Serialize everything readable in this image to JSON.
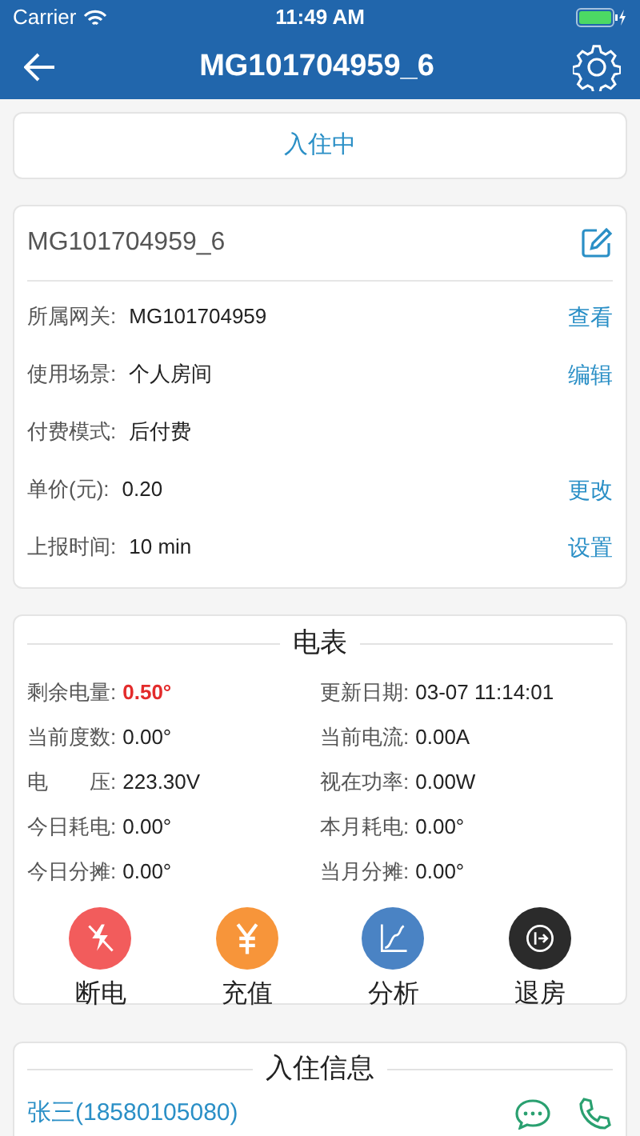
{
  "status_bar": {
    "carrier": "Carrier",
    "time": "11:49 AM"
  },
  "nav": {
    "title": "MG101704959_6"
  },
  "status_button": {
    "label": "入住中"
  },
  "device": {
    "name": "MG101704959_6",
    "rows": [
      {
        "label": "所属网关:",
        "value": "MG101704959",
        "action": "查看"
      },
      {
        "label": "使用场景:",
        "value": "个人房间",
        "action": "编辑"
      },
      {
        "label": "付费模式:",
        "value": "后付费"
      },
      {
        "label": "单价(元):",
        "value": "0.20",
        "action": "更改"
      },
      {
        "label": "上报时间:",
        "value": "10 min",
        "action": "设置"
      }
    ]
  },
  "meter": {
    "title": "电表",
    "readings": [
      {
        "label": "剩余电量:",
        "value": "0.50°",
        "alert": true
      },
      {
        "label": "更新日期:",
        "value": "03-07 11:14:01",
        "alert": false
      },
      {
        "label": "当前度数:",
        "value": "0.00°",
        "alert": false
      },
      {
        "label": "当前电流:",
        "value": "0.00A",
        "alert": false
      },
      {
        "label": "电　　压:",
        "value": "223.30V",
        "alert": false
      },
      {
        "label": "视在功率:",
        "value": "0.00W",
        "alert": false
      },
      {
        "label": "今日耗电:",
        "value": "0.00°",
        "alert": false
      },
      {
        "label": "本月耗电:",
        "value": "0.00°",
        "alert": false
      },
      {
        "label": "今日分摊:",
        "value": "0.00°",
        "alert": false
      },
      {
        "label": "当月分摊:",
        "value": "0.00°",
        "alert": false
      }
    ],
    "actions": [
      {
        "kind": "power-off",
        "label": "断电",
        "color": "#f25c5c"
      },
      {
        "kind": "recharge",
        "label": "充值",
        "color": "#f7953a"
      },
      {
        "kind": "analysis",
        "label": "分析",
        "color": "#4a83c4"
      },
      {
        "kind": "checkout",
        "label": "退房",
        "color": "#2b2b2b"
      }
    ]
  },
  "tenants": {
    "title": "入住信息",
    "items": [
      {
        "name": "张三(18580105080)"
      }
    ]
  }
}
